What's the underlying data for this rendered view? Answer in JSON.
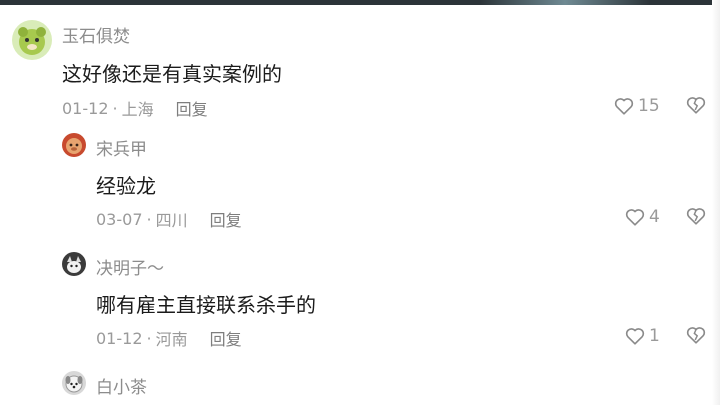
{
  "comments": [
    {
      "author": "玉石俱焚",
      "text": "这好像还是有真实案例的",
      "date": "01-12",
      "location": "上海",
      "reply_label": "回复",
      "likes": "15",
      "avatar_icon": "green-dog-avatar"
    },
    {
      "author": "宋兵甲",
      "text": "经验龙",
      "date": "03-07",
      "location": "四川",
      "reply_label": "回复",
      "likes": "4",
      "avatar_icon": "monkey-avatar"
    },
    {
      "author": "决明子～",
      "text": "哪有雇主直接联系杀手的",
      "date": "01-12",
      "location": "河南",
      "reply_label": "回复",
      "likes": "1",
      "avatar_icon": "cat-avatar"
    },
    {
      "author": "白小茶",
      "avatar_icon": "dog-avatar"
    }
  ],
  "meta_separator": "·",
  "icons": {
    "like": "heart-outline-icon",
    "dislike": "broken-heart-icon"
  }
}
